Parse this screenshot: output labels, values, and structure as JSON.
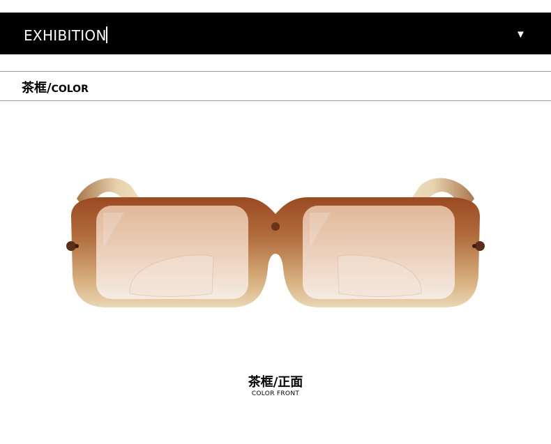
{
  "banner": {
    "title": "EXHIBITION",
    "arrow_icon": "triangle-down-icon"
  },
  "color_section": {
    "label_cn": "茶框/",
    "label_en": "COLOR"
  },
  "product": {
    "image_icon": "sunglasses-icon",
    "frame_color": "#9b4a21",
    "frame_fade_color": "#e9d4b0",
    "lens_color": "#e8c4a8"
  },
  "caption": {
    "title_cn": "茶框/正面",
    "subtitle_en": "COLOR FRONT"
  }
}
